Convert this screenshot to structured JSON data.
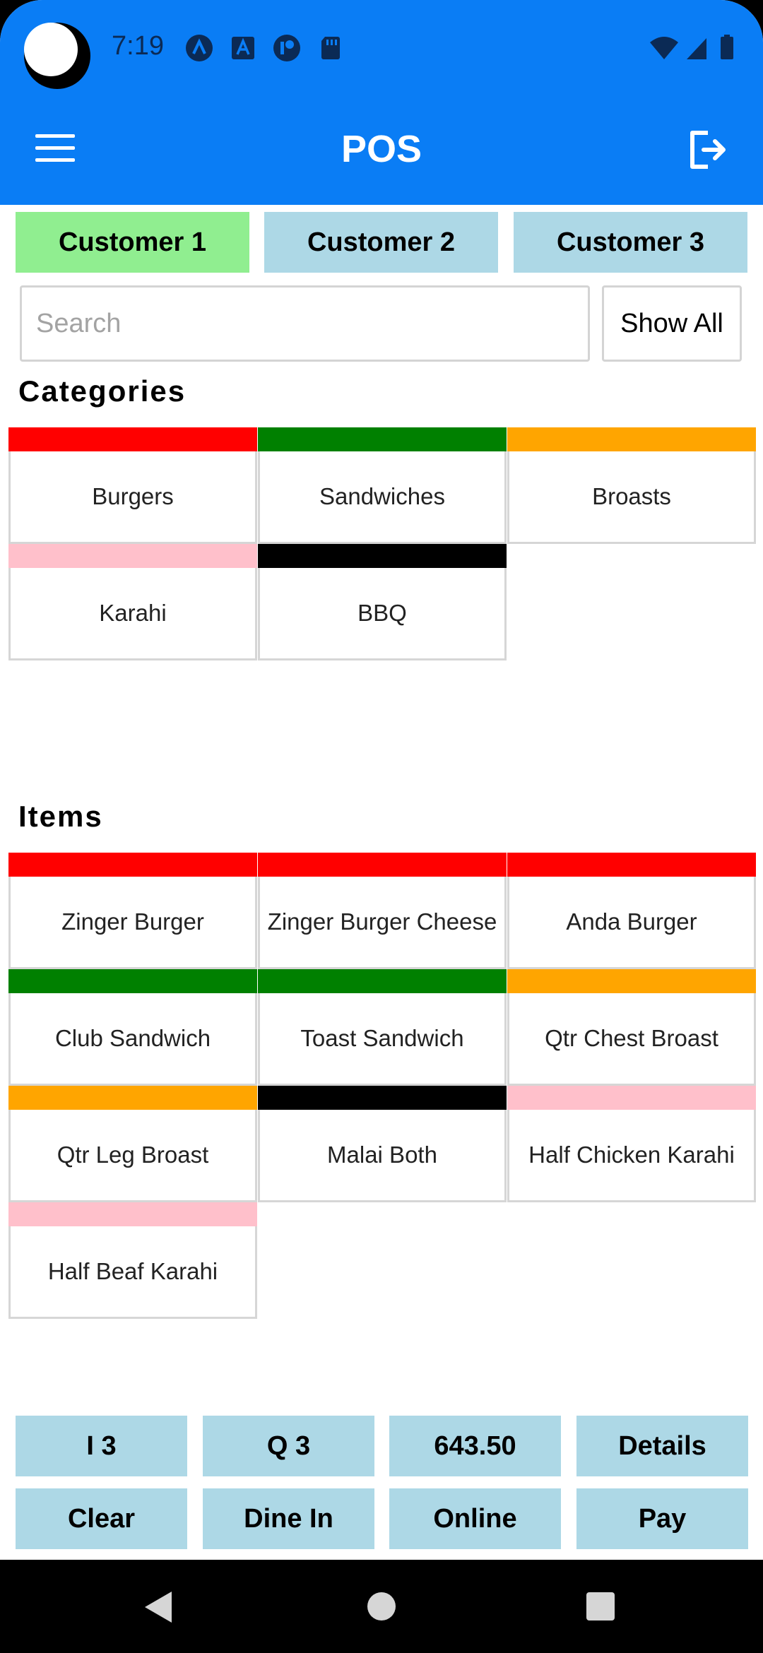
{
  "status_bar": {
    "time": "7:19"
  },
  "app_bar": {
    "title": "POS"
  },
  "customers": [
    "Customer 1",
    "Customer 2",
    "Customer 3"
  ],
  "search": {
    "placeholder": "Search",
    "value": "",
    "show_all_label": "Show All"
  },
  "categories": {
    "title": "Categories",
    "items": [
      {
        "label": "Burgers",
        "color": "#ff0000"
      },
      {
        "label": "Sandwiches",
        "color": "#008000"
      },
      {
        "label": "Broasts",
        "color": "#ffa500"
      },
      {
        "label": "Karahi",
        "color": "#ffc0cb"
      },
      {
        "label": "BBQ",
        "color": "#000000"
      }
    ]
  },
  "items": {
    "title": "Items",
    "list": [
      {
        "label": "Zinger Burger",
        "color": "#ff0000"
      },
      {
        "label": "Zinger Burger Cheese",
        "color": "#ff0000"
      },
      {
        "label": "Anda Burger",
        "color": "#ff0000"
      },
      {
        "label": "Club Sandwich",
        "color": "#008000"
      },
      {
        "label": "Toast Sandwich",
        "color": "#008000"
      },
      {
        "label": "Qtr Chest Broast",
        "color": "#ffa500"
      },
      {
        "label": "Qtr Leg Broast",
        "color": "#ffa500"
      },
      {
        "label": "Malai Both",
        "color": "#000000"
      },
      {
        "label": "Half Chicken Karahi",
        "color": "#ffc0cb"
      },
      {
        "label": "Half Beaf Karahi",
        "color": "#ffc0cb"
      }
    ]
  },
  "summary": {
    "items_count": "I 3",
    "quantity": "Q 3",
    "total": "643.50",
    "details_label": "Details"
  },
  "actions": {
    "clear": "Clear",
    "dine_in": "Dine In",
    "online": "Online",
    "pay": "Pay"
  },
  "colors": {
    "primary": "#0a7df5",
    "tab_active": "#90ee90",
    "button": "#add8e6"
  }
}
